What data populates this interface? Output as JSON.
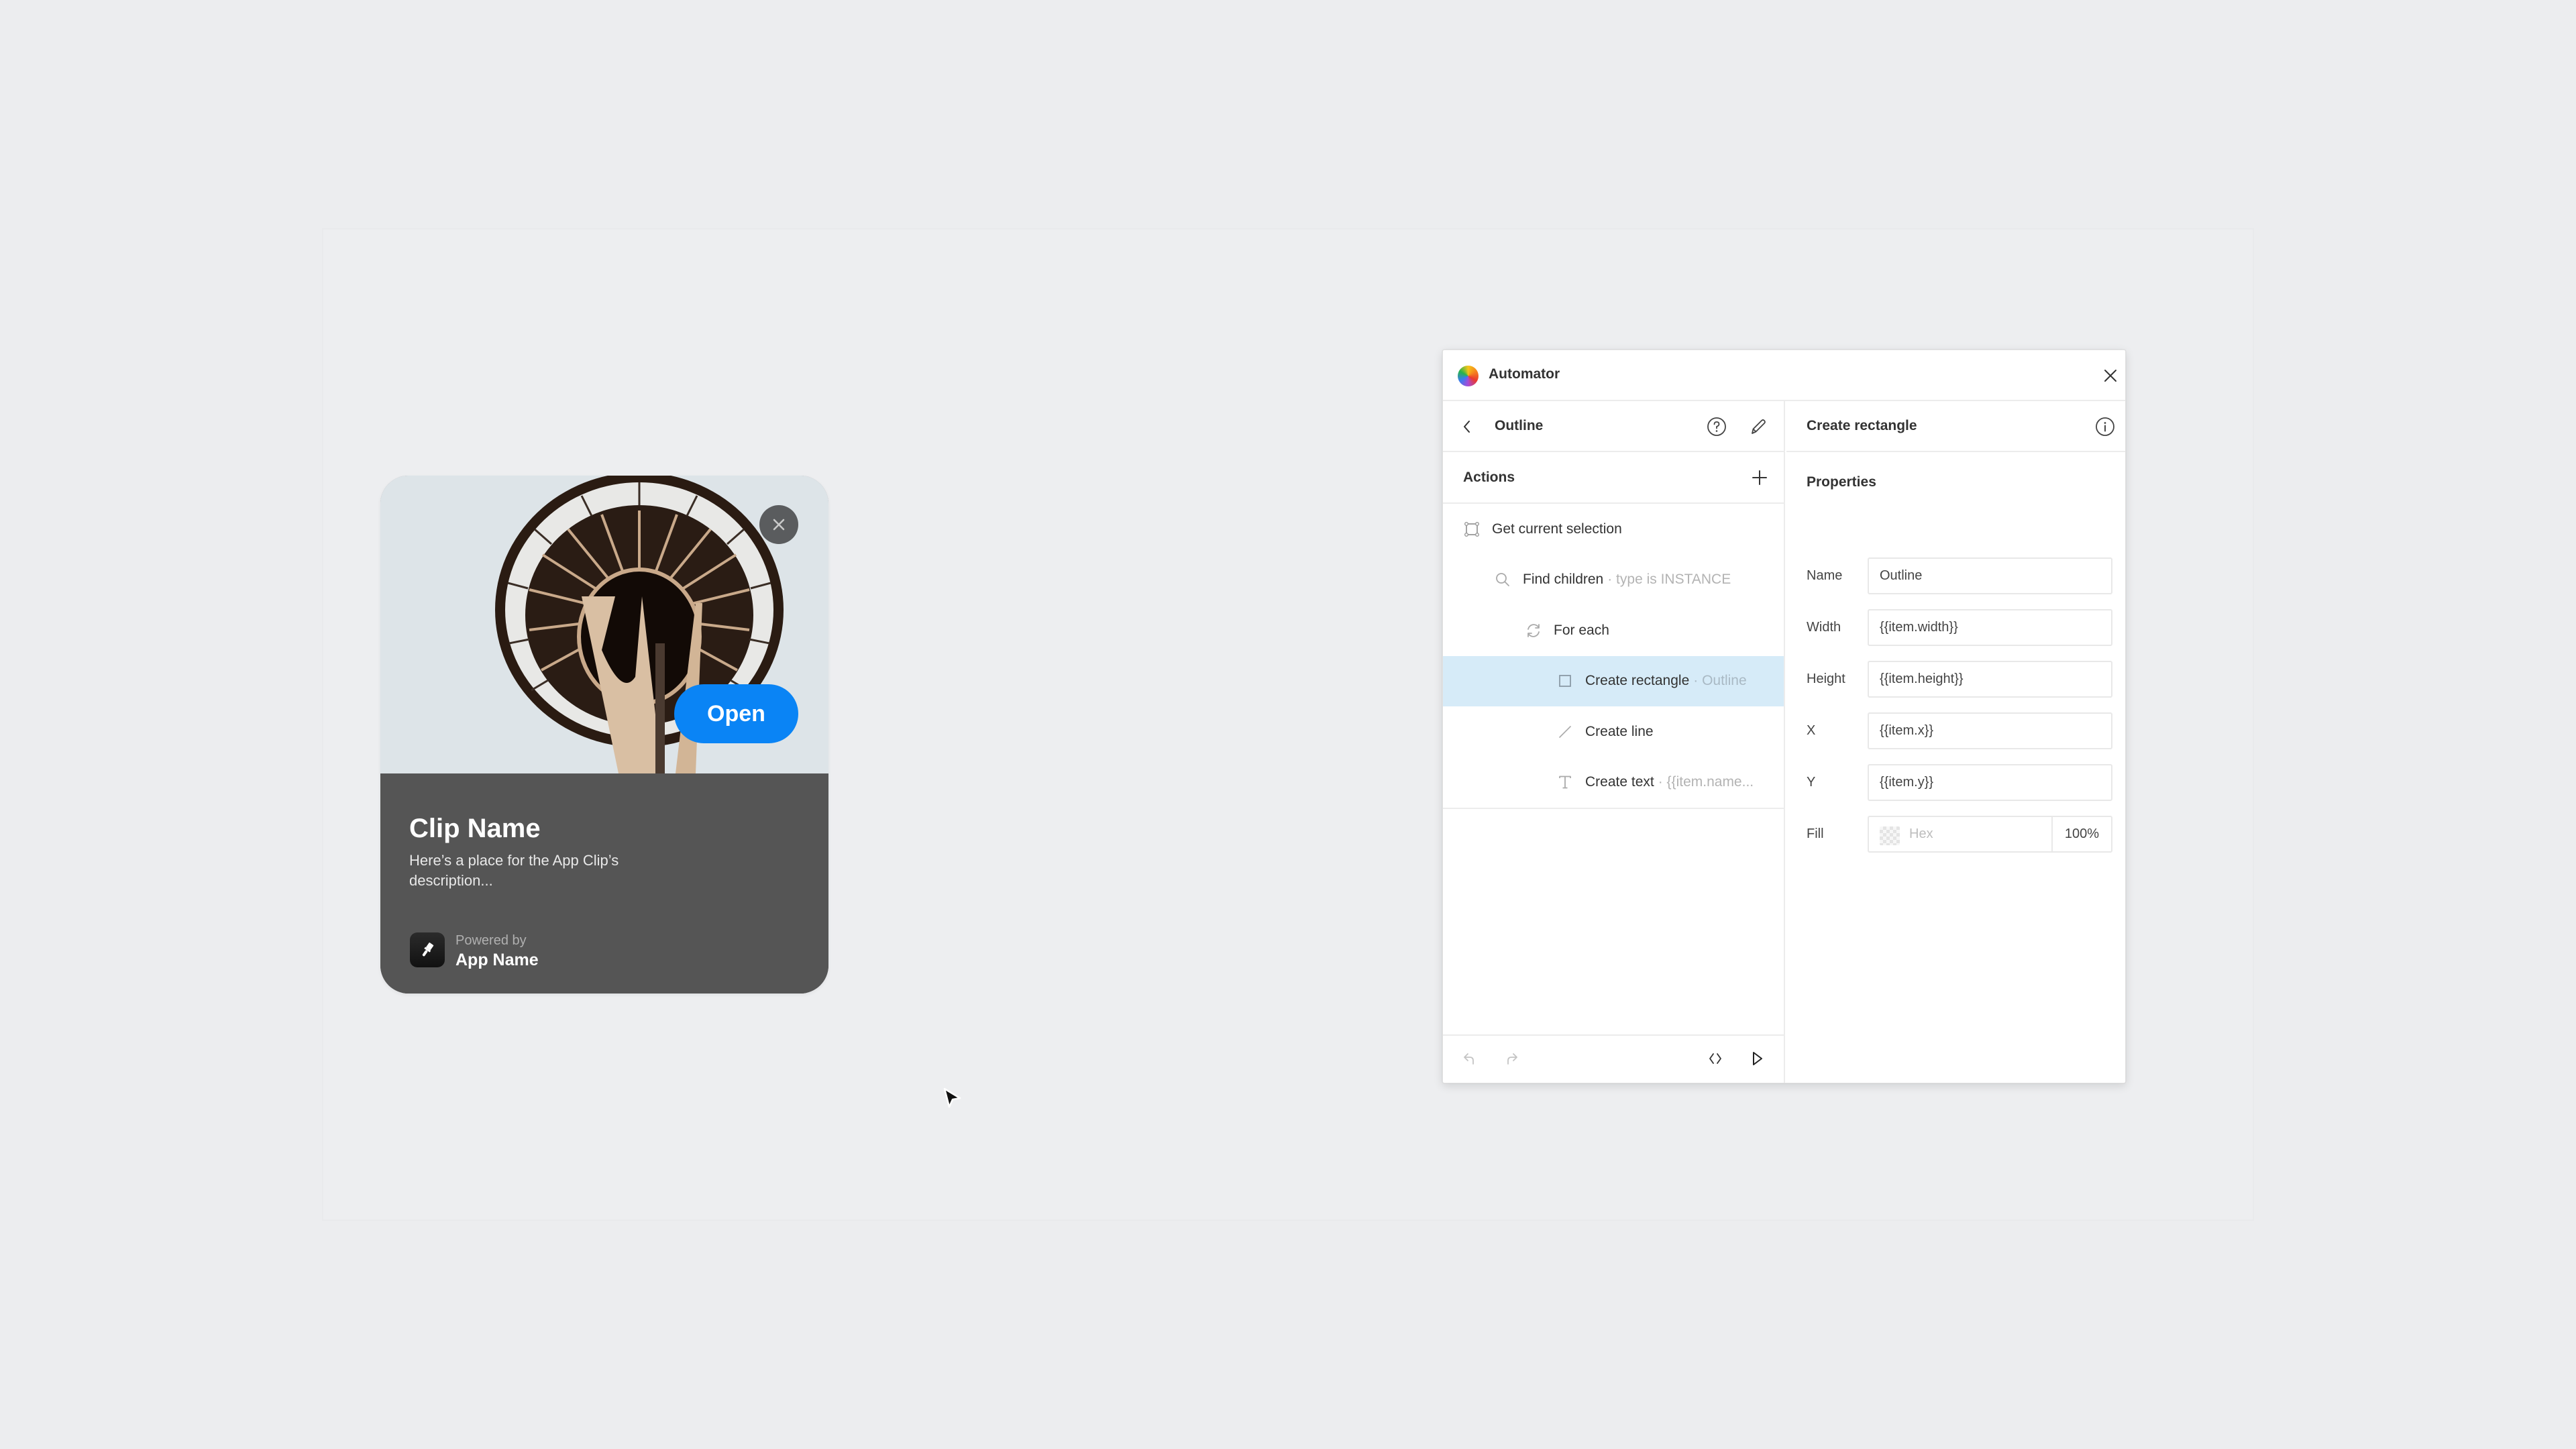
{
  "app_clip": {
    "title": "Clip Name",
    "description": "Here’s a place for the App Clip’s description...",
    "open_label": "Open",
    "powered_by": "Powered by",
    "app_name": "App Name",
    "colors": {
      "open_button": "#0a84f5",
      "body": "#555555"
    }
  },
  "plugin": {
    "title": "Automator",
    "left_pane": {
      "automation_name": "Outline",
      "actions_heading": "Actions",
      "actions": [
        {
          "icon": "selection-icon",
          "label": "Get current selection",
          "detail": "",
          "indent": 0,
          "selected": false
        },
        {
          "icon": "search-icon",
          "label": "Find children",
          "detail": "· type is INSTANCE",
          "indent": 1,
          "selected": false
        },
        {
          "icon": "loop-icon",
          "label": "For each",
          "detail": "",
          "indent": 2,
          "selected": false
        },
        {
          "icon": "rectangle-icon",
          "label": "Create rectangle",
          "detail": "· Outline",
          "indent": 3,
          "selected": true
        },
        {
          "icon": "line-icon",
          "label": "Create line",
          "detail": "",
          "indent": 3,
          "selected": false
        },
        {
          "icon": "text-icon",
          "label": "Create text",
          "detail": "· {{item.name...",
          "indent": 3,
          "selected": false
        }
      ]
    },
    "right_pane": {
      "title": "Create rectangle",
      "properties_heading": "Properties",
      "fields": [
        {
          "label": "Name",
          "value": "Outline"
        },
        {
          "label": "Width",
          "value": "{{item.width}}"
        },
        {
          "label": "Height",
          "value": "{{item.height}}"
        },
        {
          "label": "X",
          "value": "{{item.x}}"
        },
        {
          "label": "Y",
          "value": "{{item.y}}"
        }
      ],
      "fill": {
        "label": "Fill",
        "hex_value": "",
        "hex_placeholder": "Hex",
        "opacity": "100%"
      }
    },
    "colors": {
      "selected_row": "#d6ebf8"
    }
  }
}
